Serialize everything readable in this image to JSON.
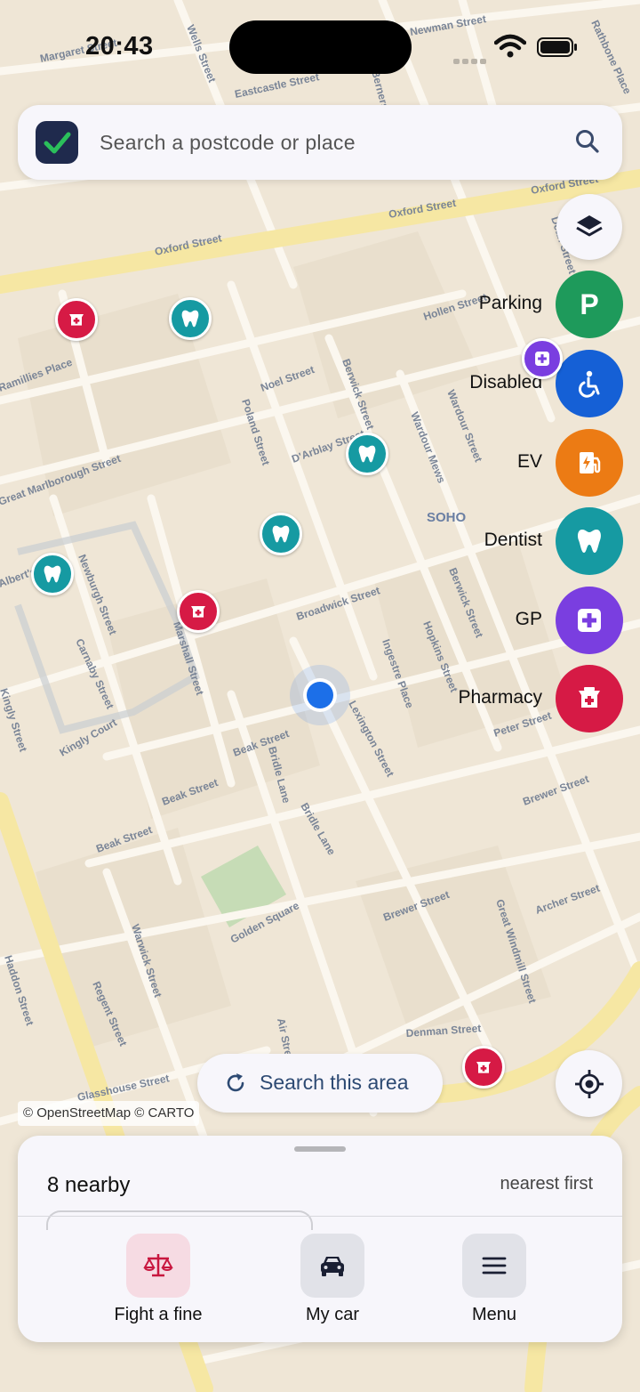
{
  "status_bar": {
    "time": "20:43"
  },
  "search": {
    "placeholder": "Search a postcode or place"
  },
  "map": {
    "attribution": "© OpenStreetMap © CARTO",
    "district_label": "SOHO",
    "street_labels": [
      "Margaret Street",
      "Wells Street",
      "Newman Street",
      "Berners Street",
      "Rathbone Place",
      "Eastcastle Street",
      "Oxford Street",
      "Oxford Street",
      "Oxford Street",
      "Dean Street",
      "Hollen Street",
      "Noel Street",
      "Ramillies Place",
      "Berwick Street",
      "D'Arblay Street",
      "Wardour Mews",
      "Wardour Street",
      "Poland Street",
      "Great Marlborough Street",
      "Newburgh Street",
      "Carnaby Street",
      "Broadwick Street",
      "Marshall Street",
      "Ingestre Place",
      "Hopkins Street",
      "Berwick Street",
      "Peter Street",
      "Kingly Court",
      "Beak Street",
      "Beak Street",
      "Beak Street",
      "Bridle Lane",
      "Bridle Lane",
      "Lexington Street",
      "Brewer Street",
      "Brewer Street",
      "Great Windmill Street",
      "Archer Street",
      "Golden Square",
      "Warwick Street",
      "Regent Street",
      "Air Street",
      "Denman Street",
      "Glasshouse Street",
      "Kingly Street",
      "Albert's Place",
      "Haddon Street"
    ]
  },
  "categories": [
    {
      "label": "Parking",
      "color": "#1e9a5b",
      "icon": "parking-icon"
    },
    {
      "label": "Disabled",
      "color": "#1560d6",
      "icon": "wheelchair-icon"
    },
    {
      "label": "EV",
      "color": "#ec7b14",
      "icon": "ev-charger-icon"
    },
    {
      "label": "Dentist",
      "color": "#169aa2",
      "icon": "tooth-icon"
    },
    {
      "label": "GP",
      "color": "#7a3ee0",
      "icon": "medical-cross-icon"
    },
    {
      "label": "Pharmacy",
      "color": "#d61a45",
      "icon": "pharmacy-icon"
    }
  ],
  "actions": {
    "search_area": "Search this area"
  },
  "sheet": {
    "count": "8 nearby",
    "sort": "nearest first"
  },
  "nav": [
    {
      "label": "Fight a fine",
      "icon": "scales-icon"
    },
    {
      "label": "My car",
      "icon": "car-icon"
    },
    {
      "label": "Menu",
      "icon": "hamburger-icon"
    }
  ]
}
